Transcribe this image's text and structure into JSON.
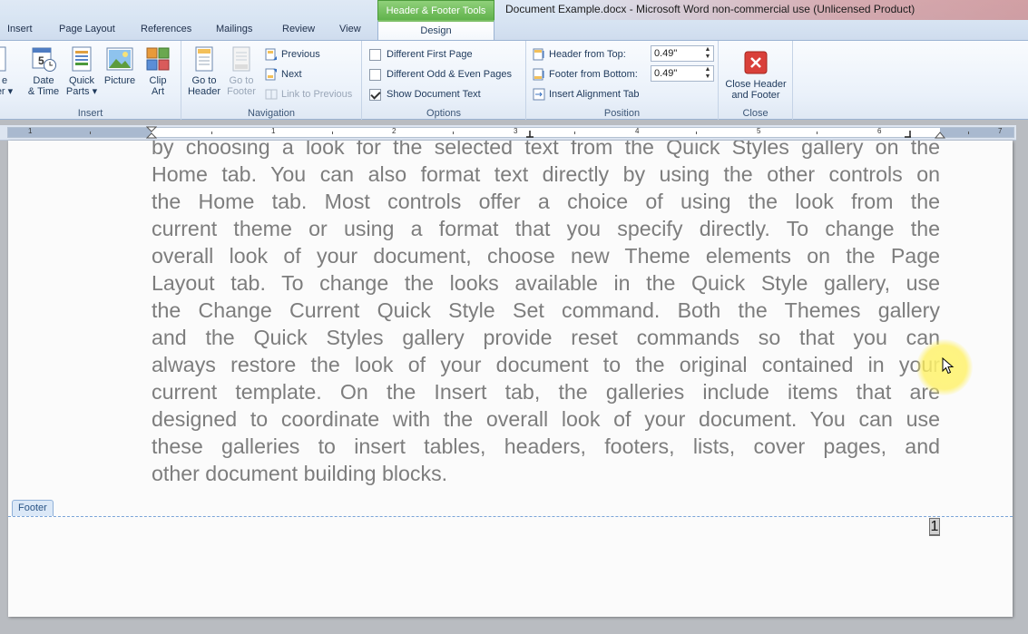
{
  "window": {
    "title": "Document Example.docx  -  Microsoft Word non-commercial use (Unlicensed Product)"
  },
  "tabs": {
    "insert": "Insert",
    "page_layout": "Page Layout",
    "references": "References",
    "mailings": "Mailings",
    "review": "Review",
    "view": "View",
    "context_header": "Header & Footer Tools",
    "design": "Design"
  },
  "ribbon": {
    "insert_group": {
      "label": "Insert",
      "partial_btn_1": "e",
      "partial_btn_2": "er",
      "date_time_1": "Date",
      "date_time_2": "& Time",
      "quick_parts_1": "Quick",
      "quick_parts_2": "Parts",
      "picture": "Picture",
      "clip_art_1": "Clip",
      "clip_art_2": "Art"
    },
    "navigation_group": {
      "label": "Navigation",
      "go_to_header_1": "Go to",
      "go_to_header_2": "Header",
      "go_to_footer_1": "Go to",
      "go_to_footer_2": "Footer",
      "previous": "Previous",
      "next": "Next",
      "link_to_previous": "Link to Previous"
    },
    "options_group": {
      "label": "Options",
      "different_first_page": "Different First Page",
      "different_odd_even": "Different Odd & Even Pages",
      "show_document_text": "Show Document Text",
      "different_first_page_checked": false,
      "different_odd_even_checked": false,
      "show_document_text_checked": true
    },
    "position_group": {
      "label": "Position",
      "header_from_top_label": "Header from Top:",
      "header_from_top_value": "0.49\"",
      "footer_from_bottom_label": "Footer from Bottom:",
      "footer_from_bottom_value": "0.49\"",
      "insert_alignment_tab": "Insert Alignment Tab"
    },
    "close_group": {
      "label": "Close",
      "close_1": "Close Header",
      "close_2": "and Footer"
    }
  },
  "ruler": {
    "numbers": [
      "1",
      "1",
      "2",
      "3",
      "4",
      "5",
      "6",
      "7"
    ]
  },
  "document": {
    "lines": [
      "by choosing a look for the selected text from the Quick Styles gallery on the",
      "Home tab. You can also format text directly by using the other controls on",
      "the Home tab. Most controls offer a choice of using the look from the",
      "current theme or using a format that you specify directly. To change the",
      "overall look of your document, choose new Theme elements on the Page",
      "Layout tab. To change the looks available in the Quick Style gallery, use",
      "the Change Current Quick Style Set command. Both the Themes gallery",
      "and the Quick Styles gallery provide reset commands so that you can",
      "always restore the look of your document to the original contained in your",
      "current template. On the Insert tab, the galleries include items that are",
      "designed to coordinate with the overall look of your document. You can use",
      "these galleries to insert tables, headers, footers, lists, cover pages, and",
      "other document building blocks."
    ],
    "footer_tag": "Footer",
    "page_number": "1"
  }
}
